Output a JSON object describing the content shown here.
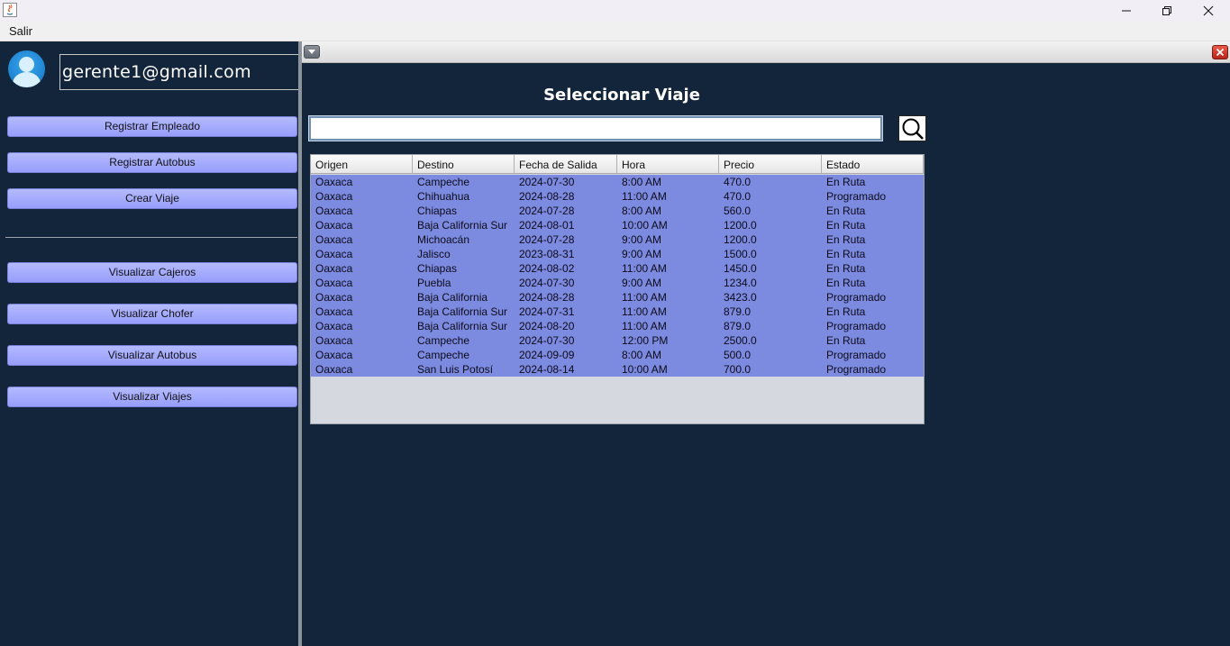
{
  "menubar": {
    "salir": "Salir"
  },
  "user": {
    "email": "gerente1@gmail.com"
  },
  "sidebar": {
    "registrar_empleado": "Registrar Empleado",
    "registrar_autobus": "Registrar Autobus",
    "crear_viaje": "Crear Viaje",
    "visualizar_cajeros": "Visualizar Cajeros",
    "visualizar_chofer": "Visualizar Chofer",
    "visualizar_autobus": "Visualizar Autobus",
    "visualizar_viajes": "Visualizar Viajes"
  },
  "frame": {
    "heading": "Seleccionar Viaje",
    "search": {
      "value": "",
      "placeholder": ""
    }
  },
  "table": {
    "columns": [
      "Origen",
      "Destino",
      "Fecha de Salida",
      "Hora",
      "Precio",
      "Estado"
    ],
    "rows": [
      [
        "Oaxaca",
        "Campeche",
        "2024-07-30",
        "8:00 AM",
        "470.0",
        "En Ruta"
      ],
      [
        "Oaxaca",
        "Chihuahua",
        "2024-08-28",
        "11:00 AM",
        "470.0",
        "Programado"
      ],
      [
        "Oaxaca",
        "Chiapas",
        "2024-07-28",
        "8:00 AM",
        "560.0",
        "En Ruta"
      ],
      [
        "Oaxaca",
        "Baja California Sur",
        "2024-08-01",
        "10:00 AM",
        "1200.0",
        "En Ruta"
      ],
      [
        "Oaxaca",
        "Michoacán",
        "2024-07-28",
        "9:00 AM",
        "1200.0",
        "En Ruta"
      ],
      [
        "Oaxaca",
        "Jalisco",
        "2023-08-31",
        "9:00 AM",
        "1500.0",
        "En Ruta"
      ],
      [
        "Oaxaca",
        "Chiapas",
        "2024-08-02",
        "11:00 AM",
        "1450.0",
        "En Ruta"
      ],
      [
        "Oaxaca",
        "Puebla",
        "2024-07-30",
        "9:00 AM",
        "1234.0",
        "En Ruta"
      ],
      [
        "Oaxaca",
        "Baja California",
        "2024-08-28",
        "11:00 AM",
        "3423.0",
        "Programado"
      ],
      [
        "Oaxaca",
        "Baja California Sur",
        "2024-07-31",
        "11:00 AM",
        "879.0",
        "En Ruta"
      ],
      [
        "Oaxaca",
        "Baja California Sur",
        "2024-08-20",
        "11:00 AM",
        "879.0",
        "Programado"
      ],
      [
        "Oaxaca",
        "Campeche",
        "2024-07-30",
        "12:00 PM",
        "2500.0",
        "En Ruta"
      ],
      [
        "Oaxaca",
        "Campeche",
        "2024-09-09",
        "8:00 AM",
        "500.0",
        "Programado"
      ],
      [
        "Oaxaca",
        "San Luis Potosí",
        "2024-08-14",
        "10:00 AM",
        "700.0",
        "Programado"
      ]
    ]
  },
  "colors": {
    "background": "#13253a",
    "button": "#a4aafd",
    "table_rows": "#7c8ae0",
    "table_empty": "#d6d8e0"
  }
}
